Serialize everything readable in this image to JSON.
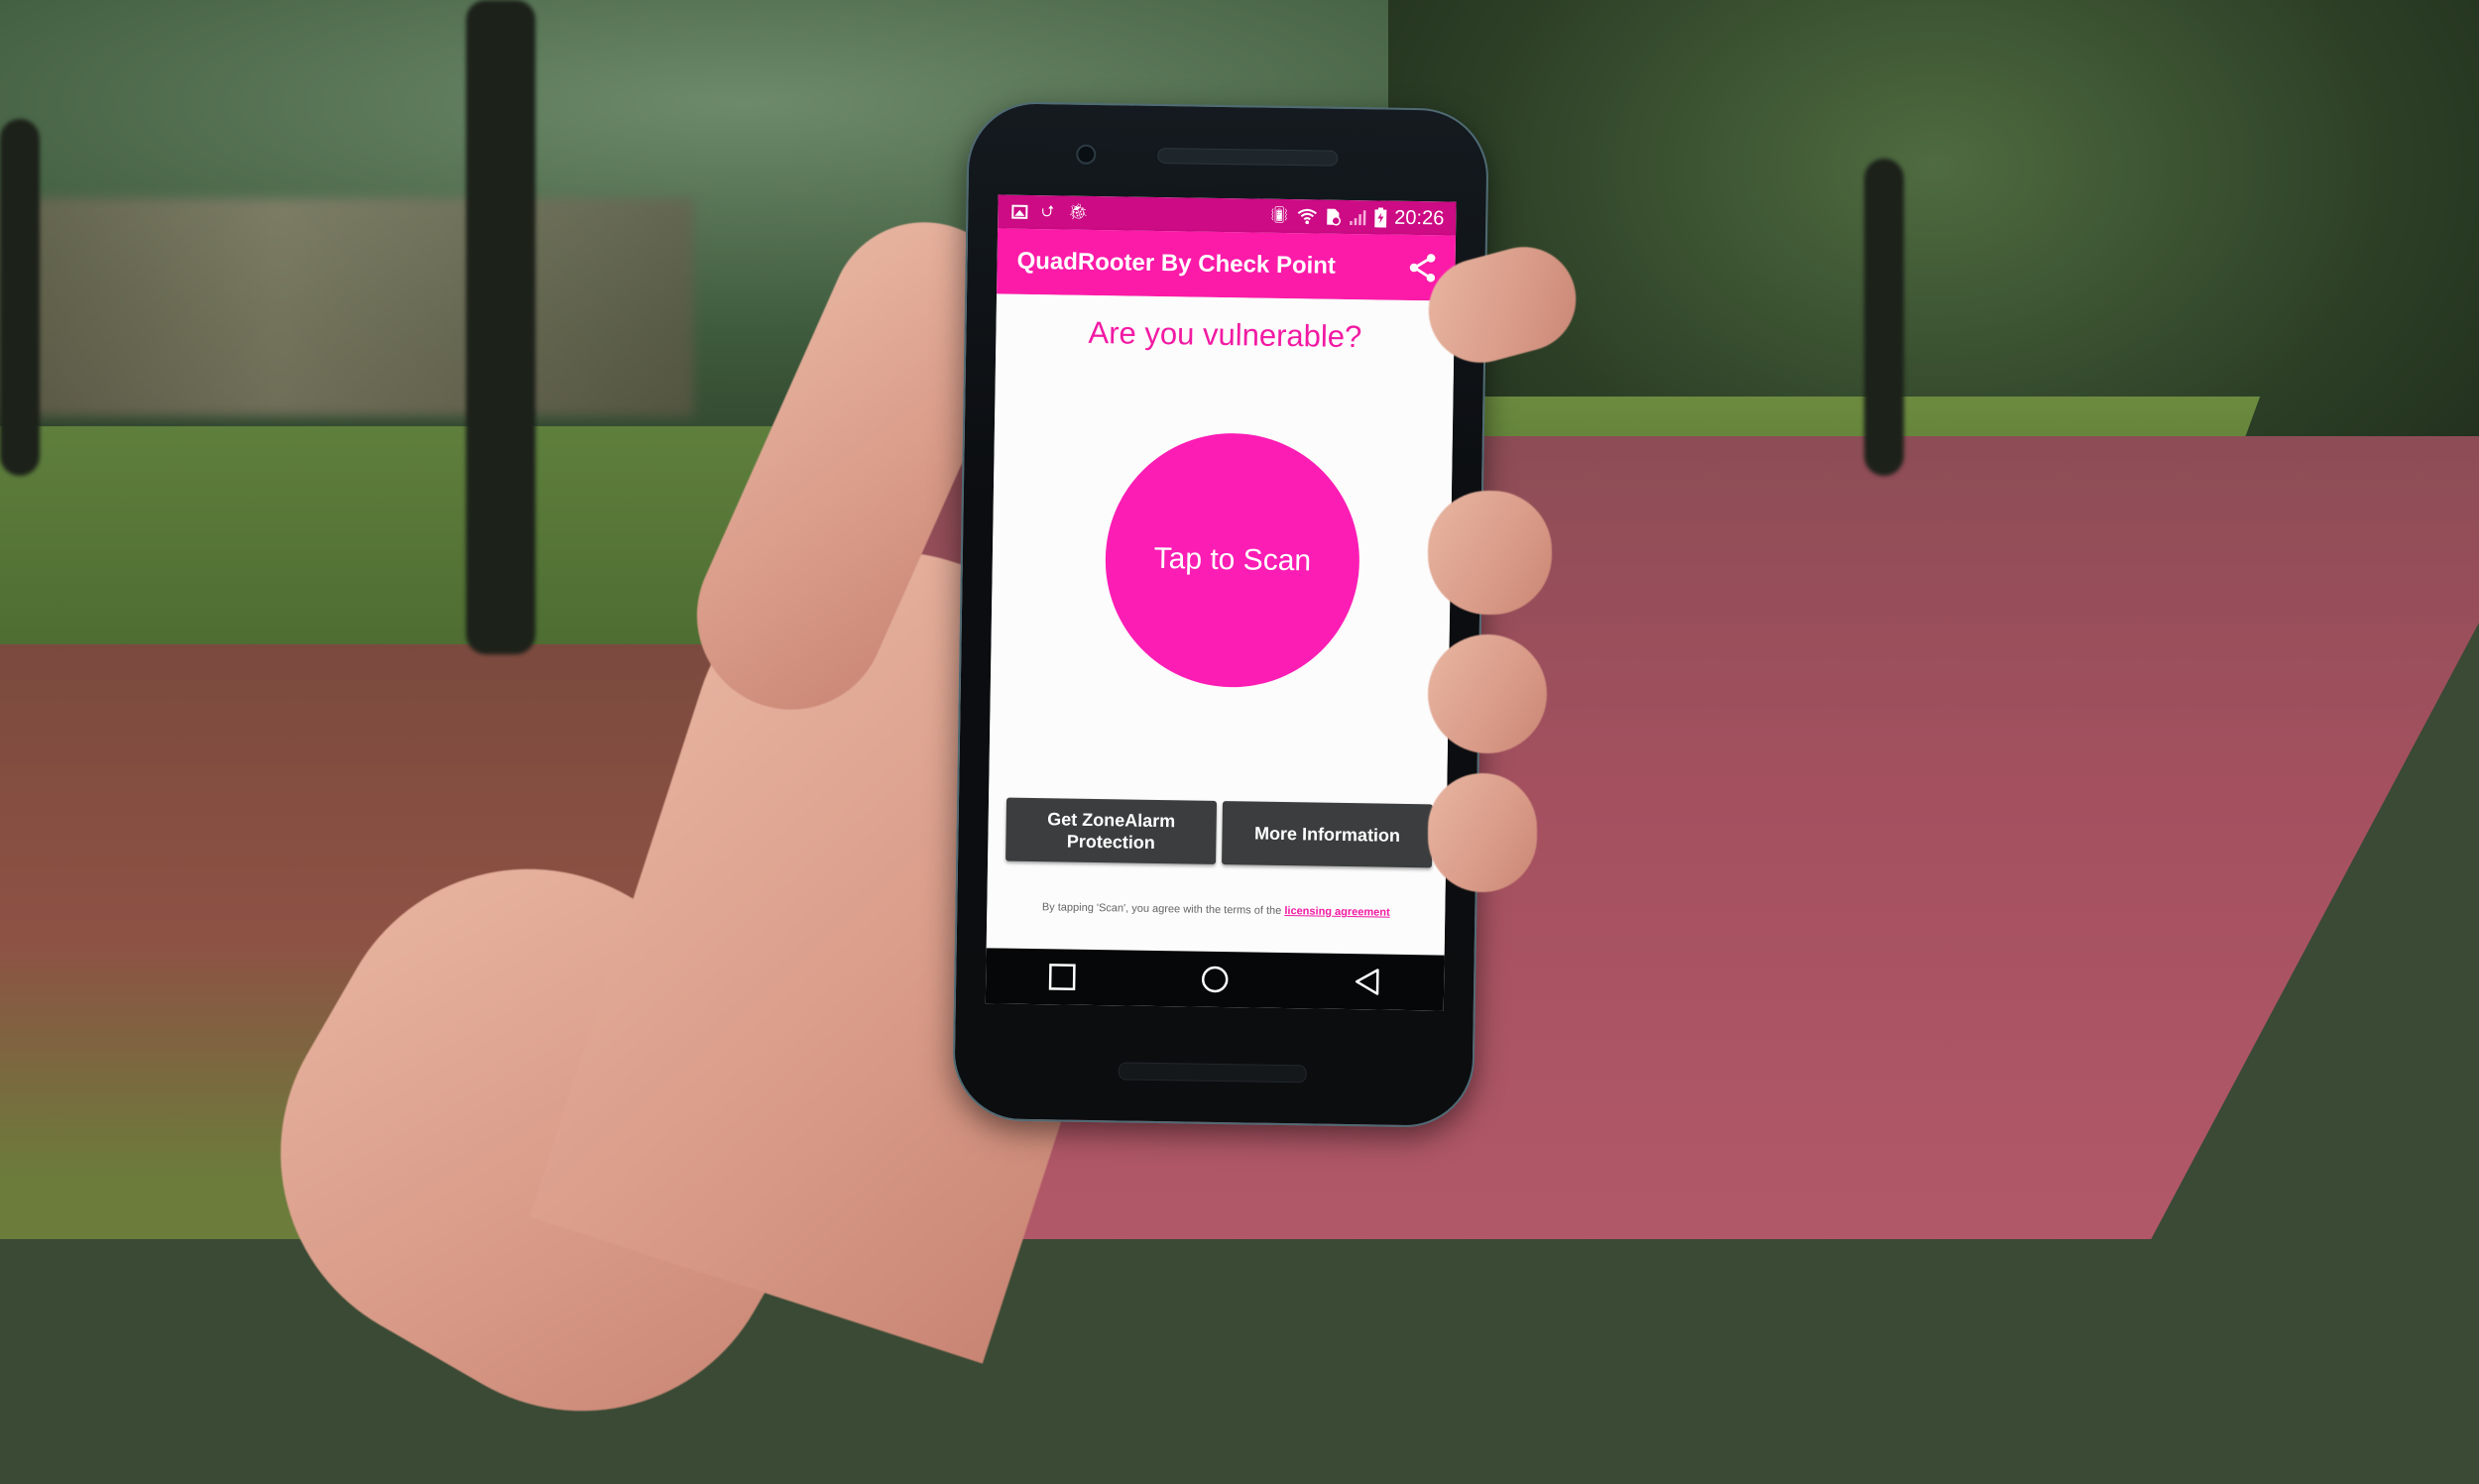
{
  "status_bar": {
    "left_icons": [
      "image-notification-icon",
      "usb-icon",
      "android-debug-icon"
    ],
    "right_icons": [
      "vibrate-icon",
      "wifi-icon",
      "sim-card-error-icon",
      "signal-icon",
      "battery-charging-icon"
    ],
    "time": "20:26"
  },
  "app_bar": {
    "title": "QuadRooter By Check Point",
    "share_icon": "share-icon"
  },
  "main": {
    "headline": "Are you vulnerable?",
    "scan_button": "Tap to Scan",
    "buttons": [
      {
        "label_line1": "Get ZoneAlarm",
        "label_line2": "Protection"
      },
      {
        "label": "More Information"
      }
    ],
    "legal_text": "By tapping 'Scan', you agree with the terms of the",
    "legal_link": "licensing agreement"
  },
  "nav_bar": {
    "items": [
      "recents-icon",
      "home-icon",
      "back-icon"
    ]
  },
  "colors": {
    "status_bar": "#cc0b84",
    "app_bar": "#fb1ba8",
    "accent": "#fc1db5",
    "button_dark": "#3b3d3e"
  }
}
